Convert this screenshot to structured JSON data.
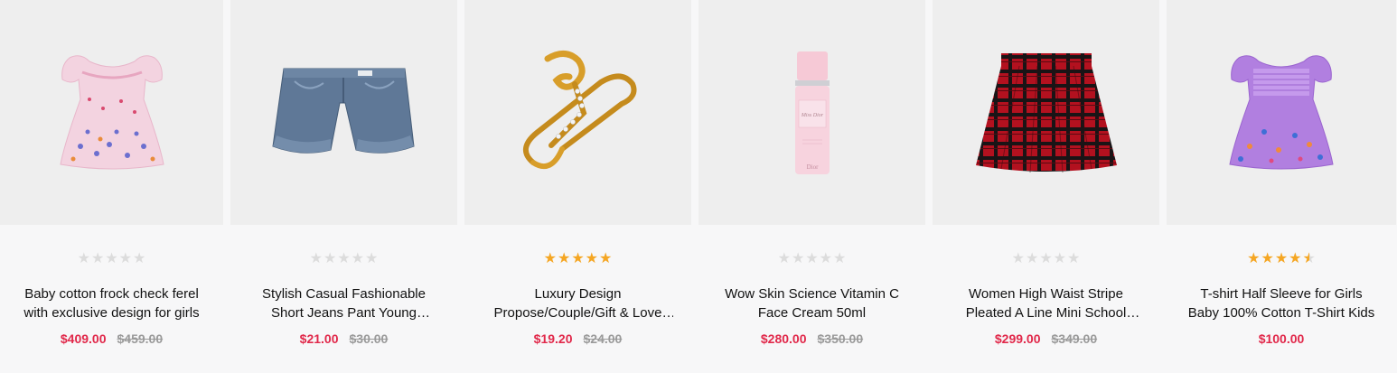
{
  "products": [
    {
      "title": "Baby cotton frock check ferel with exclusive design for girls",
      "price": "$409.00",
      "old_price": "$459.00",
      "rating": 0,
      "image_icon": "pink-butterfly-dress-icon"
    },
    {
      "title": "Stylish Casual Fashionable Short Jeans Pant Young Women",
      "price": "$21.00",
      "old_price": "$30.00",
      "rating": 0,
      "image_icon": "denim-shorts-icon"
    },
    {
      "title": "Luxury Design Propose/Couple/Gift & Love Ring",
      "price": "$19.20",
      "old_price": "$24.00",
      "rating": 5,
      "image_icon": "gold-ring-icon"
    },
    {
      "title": "Wow Skin Science Vitamin C Face Cream 50ml",
      "price": "$280.00",
      "old_price": "$350.00",
      "rating": 0,
      "image_icon": "perfume-bottle-icon"
    },
    {
      "title": "Women High Waist Stripe Pleated A Line Mini School Skirt",
      "price": "$299.00",
      "old_price": "$349.00",
      "rating": 0,
      "image_icon": "plaid-skirt-icon"
    },
    {
      "title": "T-shirt Half Sleeve for Girls Baby 100% Cotton T-Shirt Kids",
      "price": "$100.00",
      "old_price": "",
      "rating": 4.5,
      "image_icon": "purple-butterfly-dress-icon"
    }
  ],
  "colors": {
    "price": "#e1284a",
    "star": "#f5a623",
    "star_off": "#dcdcdc",
    "image_bg": "#eeeeee"
  },
  "bottle_label": "Miss Dior",
  "bottle_brand": "Dior"
}
